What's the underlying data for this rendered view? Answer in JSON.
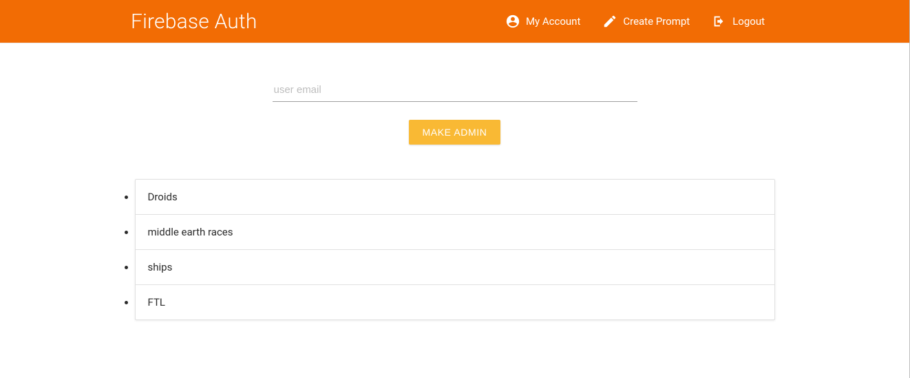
{
  "navbar": {
    "brand": "Firebase Auth",
    "links": {
      "account": "My Account",
      "create": "Create Prompt",
      "logout": "Logout"
    }
  },
  "form": {
    "email_placeholder": "user email",
    "email_value": "",
    "make_admin_label": "Make Admin"
  },
  "list": {
    "items": [
      {
        "title": "Droids"
      },
      {
        "title": "middle earth races"
      },
      {
        "title": "ships"
      },
      {
        "title": "FTL"
      }
    ]
  }
}
